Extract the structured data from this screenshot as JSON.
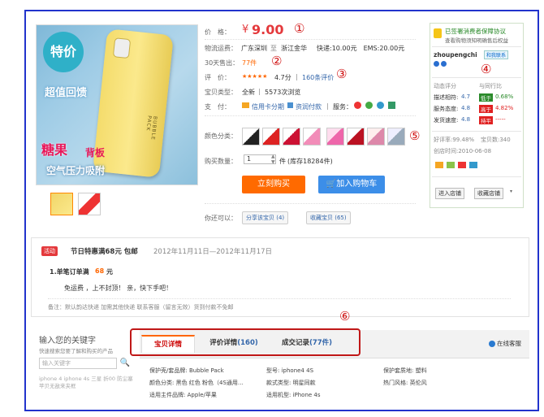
{
  "price": {
    "label": "价　格：",
    "symbol": "¥",
    "value": "9.00"
  },
  "shipping": {
    "label": "物流运费：",
    "route_from": "广东深圳",
    "route_sep": "至",
    "route_to": "浙江金华",
    "detail": "快递:10.00元　EMS:20.00元"
  },
  "sales": {
    "label": "30天售出：",
    "count": "77件"
  },
  "rating": {
    "label": "评　价：",
    "stars": "★★★★★",
    "score": "4.7分",
    "sep": "|",
    "reviews": "160条评价"
  },
  "item_type": {
    "label": "宝贝类型：",
    "condition": "全新",
    "sep": "|",
    "views": "5573次浏览"
  },
  "payment": {
    "label": "支　付：",
    "credit": "信用卡分期",
    "coupon": "资润付款",
    "sep": "|",
    "service_label": "服务："
  },
  "colors": {
    "label": "颜色分类："
  },
  "quantity": {
    "label": "购买数量：",
    "value": "1",
    "unit": "件",
    "stock": "(库存18284件)"
  },
  "buttons": {
    "buy_now": "立刻购买",
    "add_cart": "加入购物车"
  },
  "share": {
    "label": "你还可以：",
    "share_btn": "分享该宝贝 (4)",
    "fav_btn": "收藏宝贝 (65)"
  },
  "photo": {
    "badge": "特价",
    "text1": "超值回馈",
    "text2": "糖果",
    "text3": "背板",
    "text4": "空气压力吸附",
    "brand": "BUBBLE PACK"
  },
  "seller": {
    "guarantee_title": "已签署消费者保障协议",
    "guarantee_sub": "查看购物须知明确售后权益",
    "name": "zhoupengchi",
    "contact": "和我联系",
    "rating_title": "动态评分",
    "compare_title": "与同行比",
    "scores": [
      {
        "label": "描述相符:",
        "score": "4.7",
        "tag": "低于",
        "pct": "0.68%",
        "color": "#2a8a2a"
      },
      {
        "label": "服务态度:",
        "score": "4.8",
        "tag": "高于",
        "pct": "4.82%",
        "color": "#e02020"
      },
      {
        "label": "发货速度:",
        "score": "4.8",
        "tag": "持平",
        "pct": "-----",
        "color": "#e02020"
      }
    ],
    "good_rate": "好评率:99.48%",
    "items": "宝贝数:340",
    "created": "创店时间:2010-06-08",
    "enter_shop": "进入店铺",
    "fav_shop": "收藏店铺"
  },
  "promo": {
    "badge": "活动",
    "title": "节日特惠满68元 包邮",
    "dates": "2012年11月11日—2012年11月17日",
    "rule_prefix": "1.单笔订单满",
    "rule_amount": "68",
    "rule_suffix": "元",
    "benefit": "免运费 ，上不封顶！ 亲，快下手吧！",
    "note": "备注：默认韵达快递 加需其他快递 联系客服（留言无效）货到付款不免邮"
  },
  "search_panel": {
    "title": "输入您的关键字",
    "subtitle": "快速搜索您要了解和购买的产品",
    "placeholder": "输入关键字",
    "hint": "iphone 4  iphone 4s 三星 折00 防尘塞 苹贝无敌来夹框"
  },
  "tabs": [
    {
      "label": "宝贝详情"
    },
    {
      "label": "评价详情",
      "count": "(160)"
    },
    {
      "label": "成交记录",
      "count": "(77件)"
    }
  ],
  "online_service": "在线客服",
  "attributes": [
    "保护壳/套品牌: Bubble Pack",
    "型号: iphone4 4S",
    "保护套质地: 塑料",
    "颜色分类: 黑色 红色 粉色（4S通用…",
    "款式类型: 明星同款",
    "热门风格: 英伦风",
    "适用主件品牌: Apple/苹果",
    "适用机型: iPhone 4s"
  ],
  "markers": [
    "①",
    "②",
    "③",
    "④",
    "⑤",
    "⑥"
  ]
}
